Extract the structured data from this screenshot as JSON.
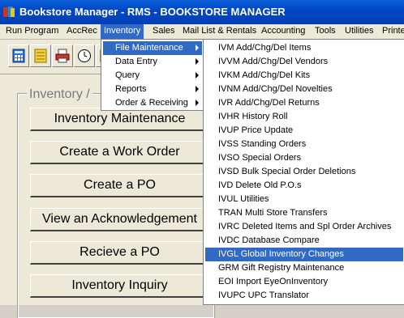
{
  "window": {
    "title": "Bookstore Manager - RMS - BOOKSTORE MANAGER"
  },
  "menubar": [
    "Run Program",
    "AccRec",
    "Inventory",
    "Sales",
    "Mail List & Rentals",
    "Accounting",
    "Tools",
    "Utilities",
    "Printe"
  ],
  "toolbar": {
    "icons": [
      "calculator-icon",
      "ledger-icon",
      "printer-icon",
      "clock-icon",
      "calendar-icon"
    ]
  },
  "main": {
    "group_label": "Inventory /",
    "buttons": [
      "Inventory Maintenance",
      "Create a Work Order",
      "Create a PO",
      "View an Acknowledgement",
      "Recieve a PO",
      "Inventory Inquiry"
    ]
  },
  "inventory_menu": [
    "File Maintenance",
    "Data Entry",
    "Query",
    "Reports",
    "Order & Receiving"
  ],
  "file_maintenance_menu": [
    "IVM  Add/Chg/Del Items",
    "IVVM Add/Chg/Del Vendors",
    "IVKM Add/Chg/Del Kits",
    "IVNM Add/Chg/Del Novelties",
    "IVR  Add/Chg/Del Returns",
    "IVHR History Roll",
    "IVUP Price Update",
    "IVSS Standing Orders",
    "IVSO Special Orders",
    "IVSD Bulk Special Order Deletions",
    "IVD  Delete Old P.O.s",
    "IVUL Utilities",
    "TRAN Multi Store Transfers",
    "IVRC Deleted Items and Spl Order Archives",
    "IVDC Database Compare",
    "IVGL Global Inventory Changes",
    "GRM  Gift Registry Maintenance",
    "EOI  Import EyeOnInventory",
    "IVUPC UPC Translator"
  ],
  "state": {
    "active_menu": "Inventory",
    "highlighted_submenu": "File Maintenance",
    "highlighted_item": "IVGL Global Inventory Changes"
  },
  "colors": {
    "title_bar": "#0047c5",
    "highlight": "#316ac5",
    "face": "#ece9d8"
  }
}
